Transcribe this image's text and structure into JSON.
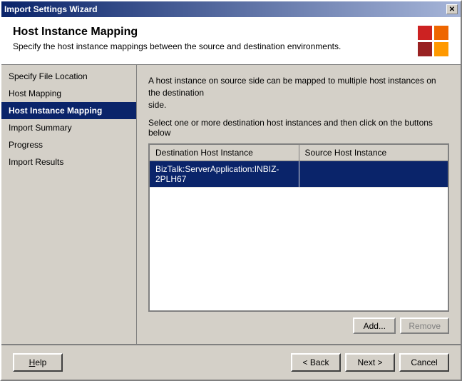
{
  "window": {
    "title": "Import Settings Wizard",
    "close_label": "✕"
  },
  "header": {
    "title": "Host Instance Mapping",
    "description": "Specify the host instance mappings between the source and destination environments.",
    "logo": {
      "squares": [
        "red",
        "orange",
        "dark-red",
        "light-orange"
      ]
    }
  },
  "sidebar": {
    "items": [
      {
        "label": "Specify File Location",
        "active": false
      },
      {
        "label": "Host Mapping",
        "active": false
      },
      {
        "label": "Host Instance Mapping",
        "active": true
      },
      {
        "label": "Import Summary",
        "active": false
      },
      {
        "label": "Progress",
        "active": false
      },
      {
        "label": "Import Results",
        "active": false
      }
    ]
  },
  "main": {
    "description_line1": "A host instance on source side can be mapped to multiple host instances on the destination",
    "description_line2": "side.",
    "instruction": "Select one or more destination host instances and then click on the buttons below",
    "table": {
      "columns": [
        "Destination Host Instance",
        "Source Host Instance"
      ],
      "rows": [
        {
          "destination": "BizTalk:ServerApplication:INBIZ-2PLH67",
          "source": "",
          "selected": true
        }
      ]
    },
    "add_button": "Add...",
    "remove_button": "Remove"
  },
  "footer": {
    "help_label": "Help",
    "back_label": "< Back",
    "next_label": "Next >",
    "cancel_label": "Cancel"
  }
}
